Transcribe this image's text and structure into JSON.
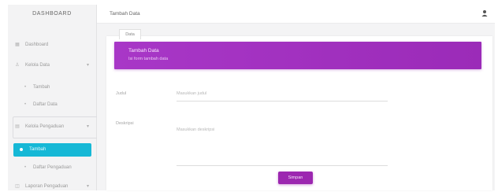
{
  "sidebar": {
    "brand": "DASHBOARD",
    "items": [
      {
        "icon": "dashboard-icon",
        "glyph": "▦",
        "label": "Dashboard"
      },
      {
        "icon": "people-icon",
        "glyph": "♙",
        "label": "Kelola Data",
        "chevron": "▾"
      },
      {
        "icon": "dot",
        "glyph": "•",
        "label": "Tambah"
      },
      {
        "icon": "dot",
        "glyph": "•",
        "label": "Daftar Data"
      },
      {
        "icon": "list-icon",
        "glyph": "▤",
        "label": "Kelola Pengaduan",
        "chevron": "▾"
      },
      {
        "icon": "dot",
        "glyph": "•",
        "label": "Daftar Pengaduan"
      },
      {
        "icon": "chart-icon",
        "glyph": "◫",
        "label": "Laporan Pengaduan",
        "chevron": "▾"
      }
    ],
    "active": {
      "label": "Tambah"
    }
  },
  "topbar": {
    "title": "Tambah Data",
    "user_icon": "user-icon"
  },
  "card": {
    "tab": "Data",
    "banner_title": "Tambah Data",
    "banner_subtitle": "Isi form tambah data",
    "fields": [
      {
        "label": "Judul",
        "placeholder": "Masukkan judul"
      },
      {
        "label": "Deskripsi",
        "placeholder": "Masukkan deskripsi"
      }
    ],
    "submit": "Simpan"
  },
  "colors": {
    "accent": "#9c27b0",
    "active_nav": "#16b8d6"
  }
}
